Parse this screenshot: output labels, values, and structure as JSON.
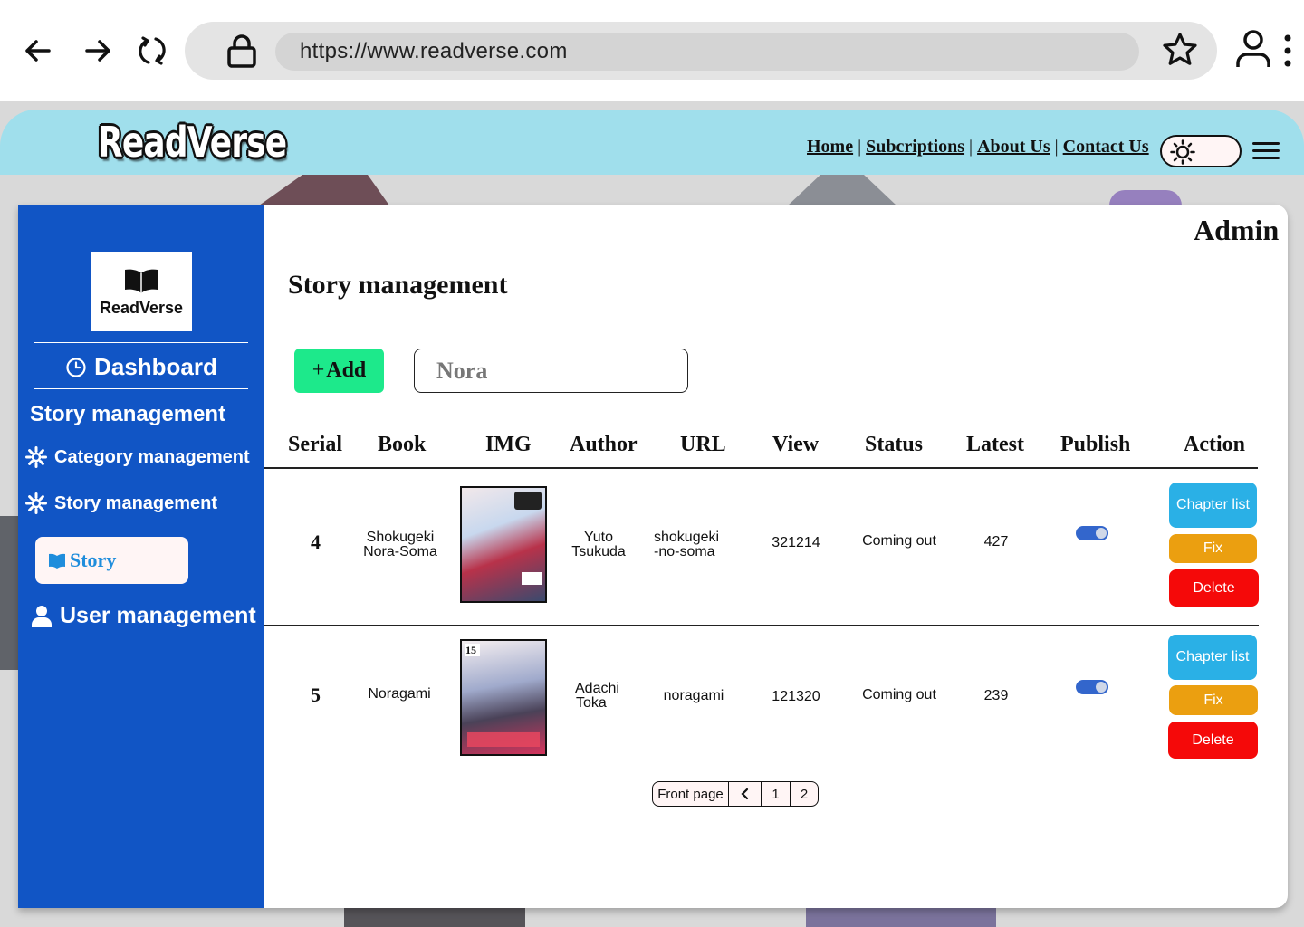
{
  "browser": {
    "url": "https://www.readverse.com"
  },
  "site": {
    "logo": "ReadVerse",
    "nav": [
      "Home",
      "Subcriptions",
      "About Us",
      "Contact Us"
    ]
  },
  "sidebar": {
    "logo_name": "ReadVerse",
    "dashboard": "Dashboard",
    "section": "Story management",
    "items": [
      {
        "label": "Category management",
        "icon": "gear-icon"
      },
      {
        "label": "Story management",
        "icon": "gear-icon"
      }
    ],
    "active_item": "Story",
    "user_management": "User management"
  },
  "main": {
    "role": "Admin",
    "title": "Story management",
    "add_label": "Add",
    "search_value": "Nora",
    "columns": [
      "Serial",
      "Book",
      "IMG",
      "Author",
      "URL",
      "View",
      "Status",
      "Latest",
      "Publish",
      "Action"
    ],
    "rows": [
      {
        "serial": "4",
        "book_line1": "Shokugeki",
        "book_line2": "Nora-Soma",
        "author_line1": "Yuto",
        "author_line2": "Tsukuda",
        "url_line1": "shokugeki",
        "url_line2": "-no-soma",
        "view": "321214",
        "status": "Coming out",
        "latest": "427",
        "published": true,
        "cover_colors": [
          "#f2e8ea",
          "#b8324a",
          "#3a4a6e"
        ]
      },
      {
        "serial": "5",
        "book_line1": "Noragami",
        "book_line2": "",
        "author_line1": "Adachi",
        "author_line2": "Toka",
        "url_line1": "noragami",
        "url_line2": "",
        "view": "121320",
        "status": "Coming out",
        "latest": "239",
        "published": true,
        "cover_colors": [
          "#f4eef0",
          "#d4345c",
          "#4a4258"
        ]
      }
    ],
    "actions": {
      "chapter": "Chapter list",
      "fix": "Fix",
      "delete": "Delete"
    },
    "pagination": {
      "front": "Front page",
      "pages": [
        "1",
        "2"
      ]
    }
  },
  "colors": {
    "header_bg": "#a0dfec",
    "sidebar_bg": "#1155c5",
    "add_button": "#1de98b",
    "chapter_button": "#2ab0e6",
    "fix_button": "#eb9f10",
    "delete_button": "#f50909"
  }
}
